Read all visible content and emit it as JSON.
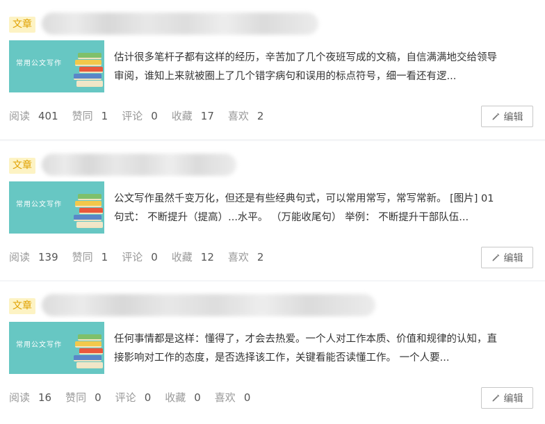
{
  "articles": [
    {
      "tag": "文章",
      "thumb_text": "常用公文写作",
      "excerpt": "估计很多笔杆子都有这样的经历，辛苦加了几个夜班写成的文稿，自信满满地交给领导审阅，谁知上来就被圈上了几个错字病句和误用的标点符号，细一看还有逻...",
      "stats": [
        {
          "label": "阅读",
          "value": "401"
        },
        {
          "label": "赞同",
          "value": "1"
        },
        {
          "label": "评论",
          "value": "0"
        },
        {
          "label": "收藏",
          "value": "17"
        },
        {
          "label": "喜欢",
          "value": "2"
        }
      ],
      "edit_label": "编辑"
    },
    {
      "tag": "文章",
      "thumb_text": "常用公文写作",
      "excerpt": "公文写作虽然千变万化，但还是有些经典句式，可以常用常写，常写常新。 [图片] 01 句式： 不断提升（提高）...水平。 （万能收尾句） 举例： 不断提升干部队伍...",
      "stats": [
        {
          "label": "阅读",
          "value": "139"
        },
        {
          "label": "赞同",
          "value": "1"
        },
        {
          "label": "评论",
          "value": "0"
        },
        {
          "label": "收藏",
          "value": "12"
        },
        {
          "label": "喜欢",
          "value": "2"
        }
      ],
      "edit_label": "编辑"
    },
    {
      "tag": "文章",
      "thumb_text": "常用公文写作",
      "excerpt": "任何事情都是这样：懂得了，才会去热爱。一个人对工作本质、价值和规律的认知，直接影响对工作的态度，是否选择该工作，关键看能否读懂工作。 一个人要...",
      "stats": [
        {
          "label": "阅读",
          "value": "16"
        },
        {
          "label": "赞同",
          "value": "0"
        },
        {
          "label": "评论",
          "value": "0"
        },
        {
          "label": "收藏",
          "value": "0"
        },
        {
          "label": "喜欢",
          "value": "0"
        }
      ],
      "edit_label": "编辑"
    }
  ],
  "colors": {
    "tag_bg": "#fdf3c4",
    "tag_text": "#e0a100",
    "thumb_bg": "#67c7c3"
  }
}
